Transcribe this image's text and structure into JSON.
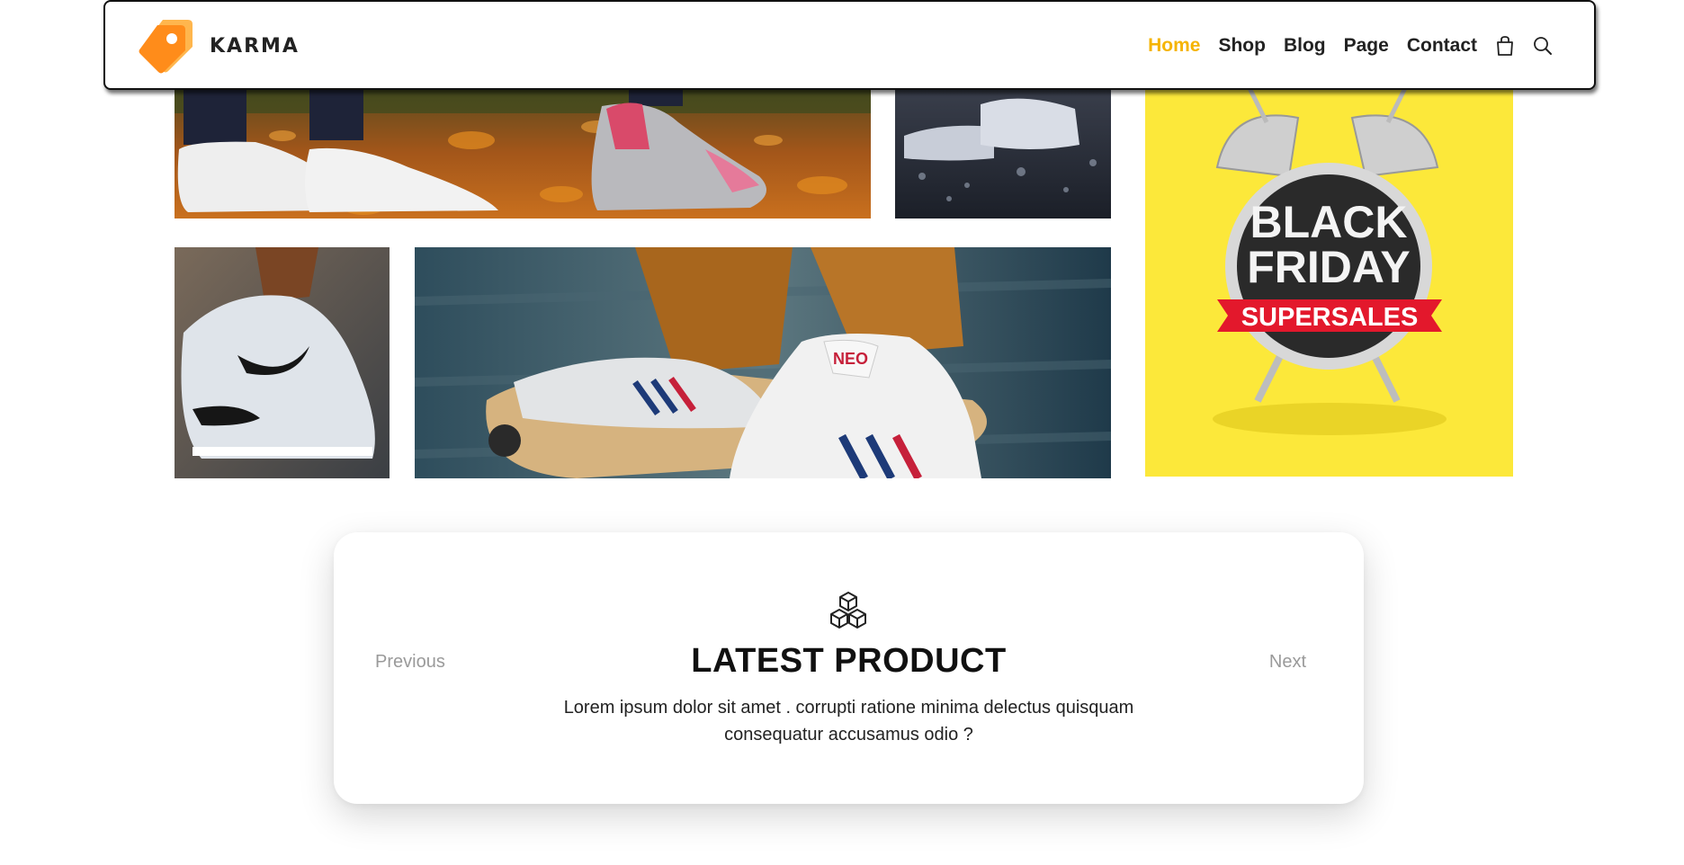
{
  "brand": {
    "name": "KARMA",
    "logo_icon": "karma-tag-logo",
    "accent_color": "#f5b400"
  },
  "nav": {
    "items": [
      {
        "label": "Home",
        "active": true
      },
      {
        "label": "Shop",
        "active": false
      },
      {
        "label": "Blog",
        "active": false
      },
      {
        "label": "Page",
        "active": false
      },
      {
        "label": "Contact",
        "active": false
      }
    ],
    "icons": [
      "shopping-bag-icon",
      "search-icon"
    ]
  },
  "gallery": {
    "promo": {
      "line1": "BLACK",
      "line2": "FRIDAY",
      "ribbon": "SUPERSALES",
      "background_color": "#fce83a"
    },
    "skate_tile": {
      "tongue_label": "NEO"
    }
  },
  "latest": {
    "icon": "cubes-icon",
    "title": "LATEST PRODUCT",
    "description": "Lorem ipsum dolor sit amet . corrupti ratione minima delectus quisquam consequatur accusamus odio ?",
    "prev_label": "Previous",
    "next_label": "Next"
  }
}
